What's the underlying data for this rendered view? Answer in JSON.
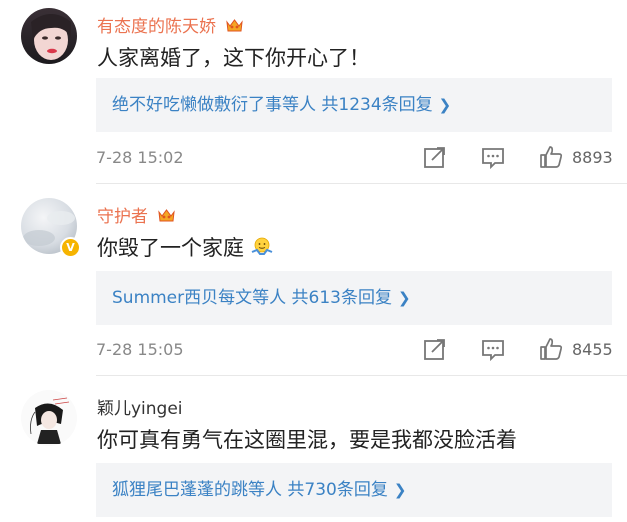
{
  "comments": [
    {
      "username": "有态度的陈天娇",
      "text": "人家离婚了，这下你开心了！",
      "reply_summary": "绝不好吃懒做敷衍了事等人  共1234条回复",
      "timestamp": "7-28 15:02",
      "likes": "8893"
    },
    {
      "username": "守护者",
      "text": "你毁了一个家庭",
      "reply_summary": "Summer西贝每文等人  共613条回复",
      "timestamp": "7-28 15:05",
      "likes": "8455"
    },
    {
      "username": "颖儿yingei",
      "text": "你可真有勇气在这圈里混，要是我都没脸活着",
      "reply_summary": "狐狸尾巴蓬蓬的跳等人  共730条回复"
    }
  ],
  "colors": {
    "username_vip": "#eb7350",
    "link_blue": "#3b82c4",
    "reply_bg": "#f3f4f6",
    "meta_gray": "#888888"
  },
  "icons": [
    "share-icon",
    "comment-icon",
    "like-icon",
    "vip-crown-icon",
    "verified-badge-icon",
    "shrug-emoji"
  ]
}
